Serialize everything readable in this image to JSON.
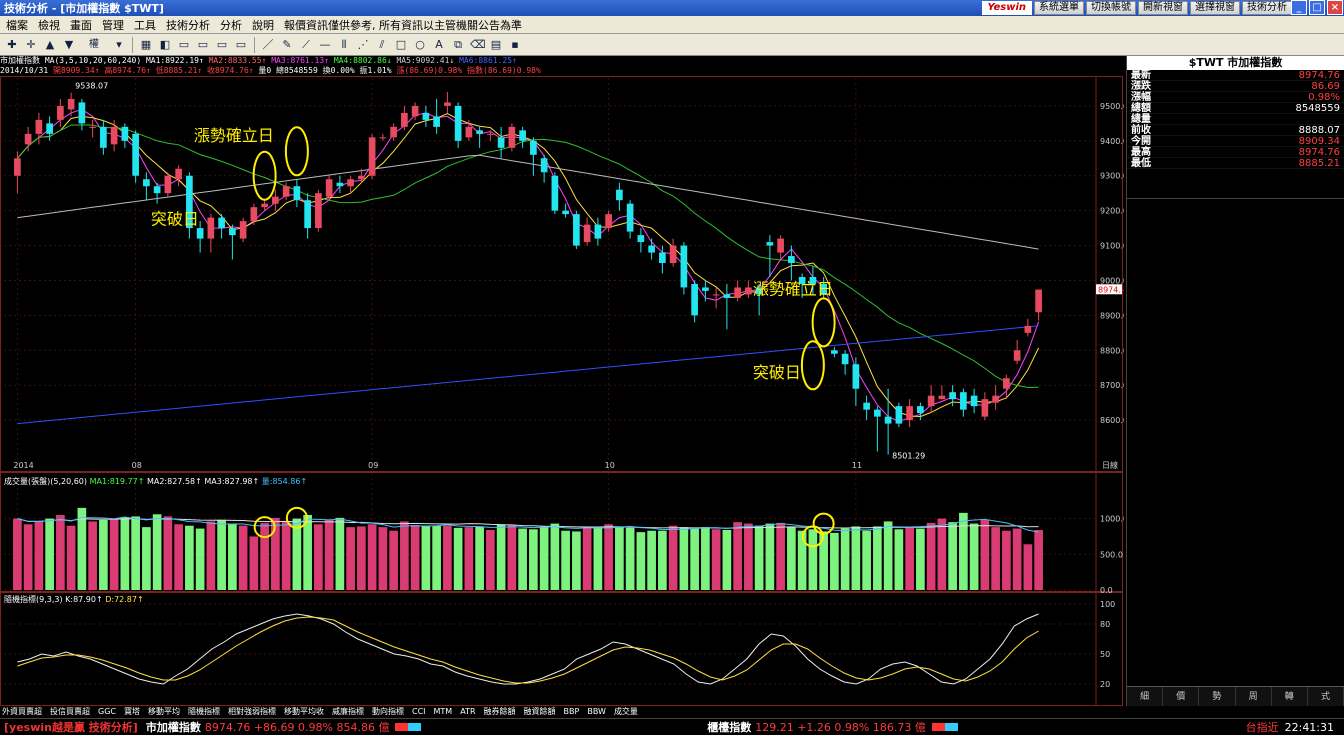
{
  "window": {
    "title": "技術分析 - [市加權指數 $TWT]",
    "brand": "Yeswin",
    "top_buttons": [
      "系統選單",
      "切換帳號",
      "開新視窗",
      "選擇視窗",
      "技術分析"
    ]
  },
  "menu": [
    "檔案",
    "檢視",
    "畫面",
    "管理",
    "工具",
    "技術分析",
    "分析",
    "說明",
    "報價資訊僅供參考, 所有資訊以主管機關公告為準"
  ],
  "toolbar": {
    "period": "權"
  },
  "info": {
    "line1": [
      {
        "t": "市加權指數",
        "c": "#ffffff"
      },
      {
        "t": " MA(3,5,10,20,60,240) ",
        "c": "#ffffff"
      },
      {
        "t": "MA1:8922.19↑",
        "c": "#ffffff"
      },
      {
        "t": " MA2:8833.55↑",
        "c": "#ff6060"
      },
      {
        "t": " MA3:8761.13↑",
        "c": "#ff40ff"
      },
      {
        "t": " MA4:8802.86↓",
        "c": "#40ff40"
      },
      {
        "t": " MA5:9092.41↓",
        "c": "#cccccc"
      },
      {
        "t": " MA6:8861.25↑",
        "c": "#4060ff"
      }
    ],
    "line2": [
      {
        "t": "2014/10/31 ",
        "c": "#ffffff"
      },
      {
        "t": "開8909.34↑",
        "c": "#ff4040"
      },
      {
        "t": " 高8974.76↑",
        "c": "#ff4040"
      },
      {
        "t": " 低8885.21↑",
        "c": "#ff4040"
      },
      {
        "t": " 收8974.76↑",
        "c": "#ff4040"
      },
      {
        "t": " 量0 總8548559",
        "c": "#ffffff"
      },
      {
        "t": " 換0.00%",
        "c": "#ffffff"
      },
      {
        "t": " 振1.01%",
        "c": "#ffffff"
      },
      {
        "t": " 漲(86.69)0.98%",
        "c": "#ff4040"
      },
      {
        "t": " 指數(86.69)0.98%",
        "c": "#ff4040"
      }
    ]
  },
  "rightpanel": {
    "title": "$TWT 市加權指數",
    "rows": [
      {
        "label": "最新",
        "value": "8974.76",
        "color": "#ff4040"
      },
      {
        "label": "漲跌",
        "value": "86.69",
        "color": "#ff4040"
      },
      {
        "label": "漲幅",
        "value": "0.98%",
        "color": "#ff4040"
      },
      {
        "label": "總額",
        "value": "8548559",
        "color": "#ffffff"
      },
      {
        "label": "總量",
        "value": "",
        "color": "#ffffff"
      },
      {
        "label": "前收",
        "value": "8888.07",
        "color": "#ffffff"
      },
      {
        "label": "今開",
        "value": "8909.34",
        "color": "#ff4040"
      },
      {
        "label": "最高",
        "value": "8974.76",
        "color": "#ff4040"
      },
      {
        "label": "最低",
        "value": "8885.21",
        "color": "#ff4040"
      }
    ],
    "tabs": [
      "細",
      "價",
      "勢",
      "周",
      "轉",
      "式"
    ]
  },
  "indicator_tabs": [
    "外資買賣超",
    "投信買賣超",
    "GGC",
    "寶塔",
    "移動平均",
    "隨機指標",
    "相對強弱指標",
    "移動平均收",
    "威廉指標",
    "動向指標",
    "CCI",
    "MTM",
    "ATR",
    "融券餘額",
    "融資餘額",
    "BBP",
    "BBW",
    "成交量"
  ],
  "status": {
    "brand": "[yeswin越是贏 技術分析]",
    "index1_name": "市加權指數",
    "index1_vals": "8974.76 +86.69 0.98% 854.86 億",
    "index2_name": "櫃檯指數",
    "index2_vals": "129.21 +1.26 0.98% 186.73 億",
    "right_label": "台指近",
    "time": "22:41:31"
  },
  "chart_data": {
    "type": "line",
    "panels": {
      "price": {
        "title": "",
        "yticks": [
          8600,
          8700,
          8800,
          8900,
          9000,
          9100,
          9200,
          9300,
          9400,
          9500
        ],
        "ylim": [
          8480,
          9580
        ],
        "last_price_label": "8974.76",
        "high_label": "9538.07",
        "low_label": "8501.29",
        "x_month_labels": [
          {
            "i": 0,
            "t": "2014"
          },
          {
            "i": 11,
            "t": "08"
          },
          {
            "i": 33,
            "t": "09"
          },
          {
            "i": 55,
            "t": "10"
          },
          {
            "i": 78,
            "t": "11"
          }
        ],
        "x_unit": "日線",
        "annotations": [
          {
            "text": "漲勢確立日",
            "i": 22,
            "price": 9400
          },
          {
            "text": "突破日",
            "i": 18,
            "price": 9160
          },
          {
            "text": "漲勢確立日",
            "i": 74,
            "price": 8960
          },
          {
            "text": "突破日",
            "i": 74,
            "price": 8720
          }
        ],
        "circles": [
          {
            "i": 23,
            "price": 9300
          },
          {
            "i": 26,
            "price": 9370
          },
          {
            "i": 74,
            "price": 8757
          },
          {
            "i": 75,
            "price": 8880
          }
        ],
        "candles": [
          [
            9300,
            9350,
            9250,
            9370
          ],
          [
            9390,
            9420,
            9370,
            9440
          ],
          [
            9420,
            9460,
            9390,
            9480
          ],
          [
            9450,
            9420,
            9400,
            9470
          ],
          [
            9460,
            9500,
            9440,
            9520
          ],
          [
            9490,
            9520,
            9470,
            9538
          ],
          [
            9510,
            9450,
            9430,
            9520
          ],
          [
            9440,
            9440,
            9410,
            9460
          ],
          [
            9440,
            9380,
            9360,
            9460
          ],
          [
            9390,
            9440,
            9370,
            9460
          ],
          [
            9440,
            9400,
            9380,
            9450
          ],
          [
            9420,
            9300,
            9280,
            9430
          ],
          [
            9290,
            9270,
            9230,
            9310
          ],
          [
            9270,
            9250,
            9220,
            9280
          ],
          [
            9250,
            9300,
            9240,
            9310
          ],
          [
            9290,
            9320,
            9270,
            9330
          ],
          [
            9300,
            9150,
            9120,
            9310
          ],
          [
            9150,
            9120,
            9080,
            9170
          ],
          [
            9120,
            9180,
            9080,
            9190
          ],
          [
            9180,
            9150,
            9120,
            9190
          ],
          [
            9150,
            9130,
            9060,
            9160
          ],
          [
            9120,
            9170,
            9110,
            9180
          ],
          [
            9170,
            9210,
            9160,
            9220
          ],
          [
            9210,
            9220,
            9200,
            9230
          ],
          [
            9220,
            9240,
            9200,
            9260
          ],
          [
            9240,
            9270,
            9230,
            9280
          ],
          [
            9270,
            9230,
            9210,
            9290
          ],
          [
            9230,
            9150,
            9120,
            9250
          ],
          [
            9150,
            9250,
            9140,
            9260
          ],
          [
            9240,
            9290,
            9230,
            9300
          ],
          [
            9280,
            9270,
            9250,
            9300
          ],
          [
            9270,
            9290,
            9250,
            9300
          ],
          [
            9290,
            9300,
            9280,
            9320
          ],
          [
            9300,
            9410,
            9290,
            9420
          ],
          [
            9410,
            9410,
            9400,
            9420
          ],
          [
            9410,
            9440,
            9400,
            9450
          ],
          [
            9440,
            9480,
            9430,
            9500
          ],
          [
            9470,
            9500,
            9460,
            9510
          ],
          [
            9480,
            9460,
            9440,
            9500
          ],
          [
            9470,
            9440,
            9420,
            9520
          ],
          [
            9500,
            9510,
            9480,
            9540
          ],
          [
            9500,
            9400,
            9380,
            9510
          ],
          [
            9410,
            9440,
            9400,
            9460
          ],
          [
            9430,
            9420,
            9380,
            9440
          ],
          [
            9420,
            9420,
            9400,
            9430
          ],
          [
            9410,
            9380,
            9350,
            9440
          ],
          [
            9380,
            9440,
            9370,
            9450
          ],
          [
            9430,
            9400,
            9380,
            9440
          ],
          [
            9400,
            9360,
            9300,
            9410
          ],
          [
            9350,
            9310,
            9280,
            9360
          ],
          [
            9300,
            9200,
            9190,
            9310
          ],
          [
            9200,
            9190,
            9180,
            9220
          ],
          [
            9190,
            9100,
            9090,
            9200
          ],
          [
            9110,
            9160,
            9100,
            9180
          ],
          [
            9160,
            9120,
            9100,
            9180
          ],
          [
            9150,
            9190,
            9140,
            9200
          ],
          [
            9260,
            9230,
            9200,
            9280
          ],
          [
            9220,
            9140,
            9120,
            9230
          ],
          [
            9130,
            9110,
            9080,
            9150
          ],
          [
            9100,
            9080,
            9060,
            9120
          ],
          [
            9080,
            9050,
            9020,
            9100
          ],
          [
            9050,
            9100,
            9040,
            9120
          ],
          [
            9100,
            8980,
            8960,
            9110
          ],
          [
            8990,
            8900,
            8880,
            9000
          ],
          [
            8980,
            8970,
            8940,
            9000
          ],
          [
            8960,
            8960,
            8920,
            8980
          ],
          [
            8960,
            8950,
            8860,
            8990
          ],
          [
            8950,
            8980,
            8940,
            9000
          ],
          [
            8960,
            8980,
            8950,
            9000
          ],
          [
            8980,
            8960,
            8900,
            8990
          ],
          [
            9110,
            9100,
            9010,
            9130
          ],
          [
            9080,
            9120,
            9060,
            9130
          ],
          [
            9070,
            9050,
            9000,
            9100
          ],
          [
            9010,
            8990,
            8950,
            9020
          ],
          [
            9010,
            8990,
            8960,
            9040
          ],
          [
            8990,
            8960,
            8950,
            9010
          ],
          [
            8800,
            8790,
            8780,
            8810
          ],
          [
            8790,
            8760,
            8730,
            8800
          ],
          [
            8760,
            8690,
            8640,
            8780
          ],
          [
            8650,
            8630,
            8600,
            8670
          ],
          [
            8630,
            8610,
            8510,
            8640
          ],
          [
            8610,
            8590,
            8501,
            8690
          ],
          [
            8640,
            8590,
            8580,
            8650
          ],
          [
            8600,
            8640,
            8580,
            8660
          ],
          [
            8640,
            8620,
            8600,
            8650
          ],
          [
            8640,
            8670,
            8620,
            8700
          ],
          [
            8660,
            8670,
            8660,
            8700
          ],
          [
            8680,
            8660,
            8640,
            8700
          ],
          [
            8680,
            8630,
            8610,
            8690
          ],
          [
            8670,
            8640,
            8620,
            8690
          ],
          [
            8610,
            8660,
            8600,
            8680
          ],
          [
            8650,
            8670,
            8630,
            8700
          ],
          [
            8690,
            8720,
            8660,
            8730
          ],
          [
            8770,
            8800,
            8760,
            8830
          ],
          [
            8850,
            8870,
            8840,
            8890
          ],
          [
            8909,
            8974,
            8885,
            8974
          ]
        ],
        "ma_lines": [
          {
            "name": "MA3",
            "color": "#ff40ff"
          },
          {
            "name": "MA5",
            "color": "#ffe040"
          },
          {
            "name": "MA20",
            "color": "#2ebf2e"
          },
          {
            "name": "MA60",
            "color": "#bbbbbb"
          },
          {
            "name": "MA240",
            "color": "#3050ff"
          }
        ]
      },
      "volume": {
        "title": "成交量(張盤)(5,20,60)",
        "labels": [
          {
            "t": "成交量(張盤)(5,20,60) ",
            "c": "#ffffff"
          },
          {
            "t": "MA1:819.77↑",
            "c": "#40ff40"
          },
          {
            "t": " MA2:827.58↑",
            "c": "#ffffff"
          },
          {
            "t": " MA3:827.98↑",
            "c": "#ffffff"
          },
          {
            "t": " 量:854.86↑",
            "c": "#40c0ff"
          }
        ],
        "yticks": [
          0,
          500,
          1000
        ],
        "ylim": [
          0,
          1400
        ],
        "values": [
          1000,
          920,
          960,
          1000,
          1050,
          900,
          1150,
          960,
          980,
          1000,
          1020,
          1030,
          880,
          1060,
          1030,
          920,
          900,
          860,
          960,
          980,
          920,
          900,
          750,
          940,
          1010,
          960,
          1000,
          1050,
          920,
          980,
          1010,
          880,
          890,
          920,
          880,
          830,
          960,
          910,
          900,
          900,
          900,
          870,
          880,
          890,
          840,
          910,
          910,
          860,
          850,
          880,
          930,
          830,
          820,
          890,
          880,
          920,
          890,
          870,
          810,
          830,
          830,
          900,
          880,
          860,
          880,
          850,
          840,
          950,
          930,
          900,
          930,
          940,
          880,
          830,
          850,
          820,
          800,
          860,
          890,
          830,
          890,
          960,
          850,
          880,
          860,
          940,
          1000,
          950,
          1080,
          930,
          980,
          880,
          830,
          860,
          640,
          840,
          700,
          780,
          860,
          840
        ]
      },
      "kd": {
        "title": "隨機指標(9,3,3)",
        "labels": [
          {
            "t": "隨機指標(9,3,3) ",
            "c": "#ffffff"
          },
          {
            "t": "K:87.90↑",
            "c": "#ffffff"
          },
          {
            "t": " D:72.87↑",
            "c": "#ffe040"
          }
        ],
        "yticks": [
          20,
          50,
          80,
          100
        ],
        "ylim": [
          0,
          100
        ],
        "K": [
          42,
          45,
          50,
          48,
          52,
          48,
          45,
          40,
          35,
          30,
          25,
          22,
          20,
          28,
          35,
          45,
          55,
          62,
          70,
          75,
          80,
          85,
          88,
          90,
          88,
          85,
          80,
          72,
          65,
          60,
          55,
          50,
          48,
          45,
          40,
          38,
          32,
          28,
          25,
          22,
          20,
          20,
          22,
          25,
          30,
          35,
          45,
          50,
          55,
          62,
          60,
          55,
          50,
          45,
          40,
          30,
          22,
          20,
          25,
          35,
          45,
          60,
          70,
          68,
          58,
          45,
          35,
          28,
          22,
          20,
          25,
          35,
          40,
          42,
          38,
          30,
          22,
          20,
          25,
          35,
          45,
          60,
          78,
          85,
          90
        ],
        "D": [
          38,
          42,
          46,
          47,
          49,
          49,
          47,
          44,
          40,
          36,
          31,
          27,
          24,
          24,
          28,
          34,
          42,
          50,
          58,
          65,
          72,
          78,
          83,
          86,
          87,
          86,
          84,
          78,
          72,
          67,
          62,
          57,
          53,
          49,
          45,
          42,
          37,
          33,
          29,
          26,
          23,
          21,
          21,
          23,
          26,
          30,
          36,
          42,
          48,
          54,
          57,
          56,
          54,
          50,
          46,
          40,
          33,
          27,
          24,
          28,
          34,
          44,
          54,
          60,
          60,
          55,
          46,
          38,
          31,
          26,
          24,
          26,
          30,
          35,
          37,
          35,
          30,
          25,
          23,
          27,
          33,
          42,
          55,
          66,
          73
        ]
      }
    }
  }
}
